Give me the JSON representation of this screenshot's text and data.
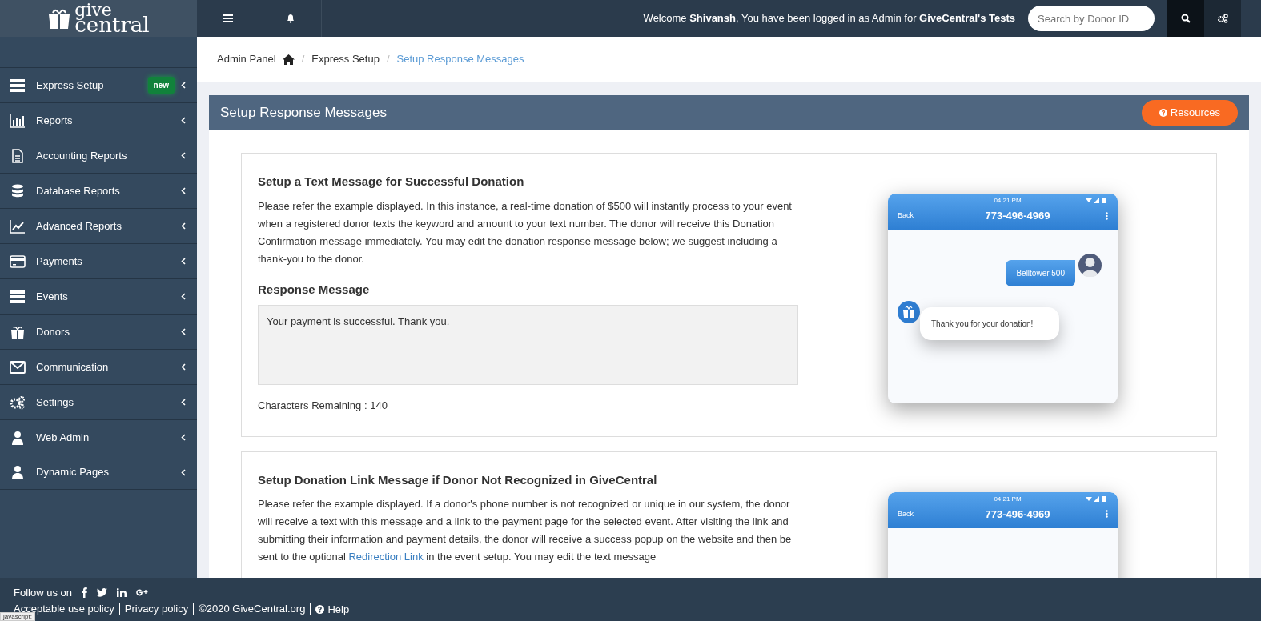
{
  "logo": {
    "line_1": "give",
    "line_2": "central"
  },
  "topbar": {
    "welcome": "Welcome **Shivansh**, You have been logged in as Admin for **GiveCentral's Tests**",
    "search": {
      "placeholder": "Search by Donor ID"
    }
  },
  "sidebar": {
    "items": [
      {
        "label": "Express Setup",
        "badge": "new"
      },
      {
        "label": "Reports"
      },
      {
        "label": "Accounting Reports"
      },
      {
        "label": "Database Reports"
      },
      {
        "label": "Advanced Reports"
      },
      {
        "label": "Payments"
      },
      {
        "label": "Events"
      },
      {
        "label": "Donors"
      },
      {
        "label": "Communication"
      },
      {
        "label": "Settings"
      },
      {
        "label": "Web Admin"
      },
      {
        "label": "Dynamic Pages"
      }
    ]
  },
  "breadcrumb": [
    {
      "label": "Admin Panel",
      "active": false
    },
    {
      "separator": "/",
      "label": "Express Setup",
      "active": false
    },
    {
      "separator": "/",
      "label": "Setup Response Messages",
      "active": true
    }
  ],
  "panel": {
    "title": "Setup Response Messages",
    "resources_button": "Resources"
  },
  "sections": [
    {
      "title": "Setup a Text Message for Successful Donation",
      "paragraph": {
        "before": "Please refer the example displayed. In this instance, a real-time donation of $500 will instantly process to your event when a registered donor texts the keyword and amount to your text number. The donor will receive this Donation Confirmation message immediately. You may edit the donation response message below; we suggest including a thank-you to the donor."
      },
      "response_label": "Response Message",
      "response_value": "Your payment is successful. Thank you.",
      "remaining": "Characters Remaining : 140",
      "phone": {
        "time": "04:21 PM",
        "back": "Back",
        "number": "773-496-4969",
        "messages": [
          {
            "kind": "sent",
            "text": "Belltower 500"
          },
          {
            "kind": "received",
            "text": "Thank you for your donation!"
          }
        ]
      }
    },
    {
      "title": "Setup Donation Link Message if Donor Not Recognized in GiveCentral",
      "paragraph": {
        "before": "Please refer the example displayed. If a donor's phone number is not recognized or unique in our system, the donor will receive a text with this message and a link to the payment page for the selected event. After visiting the link and submitting their information and payment details, the donor will receive a success popup on the website and then be sent to the optional ",
        "link": "Redirection Link",
        "after": " in the event setup. You may edit the text message"
      },
      "phone": {
        "time": "04:21 PM",
        "back": "Back",
        "number": "773-496-4969"
      }
    }
  ],
  "footer": {
    "follow": "Follow us on",
    "links": [
      "Acceptable use policy",
      "Privacy policy",
      "©2020 GiveCentral.org",
      "Help"
    ]
  },
  "status_bar": "javascript:"
}
